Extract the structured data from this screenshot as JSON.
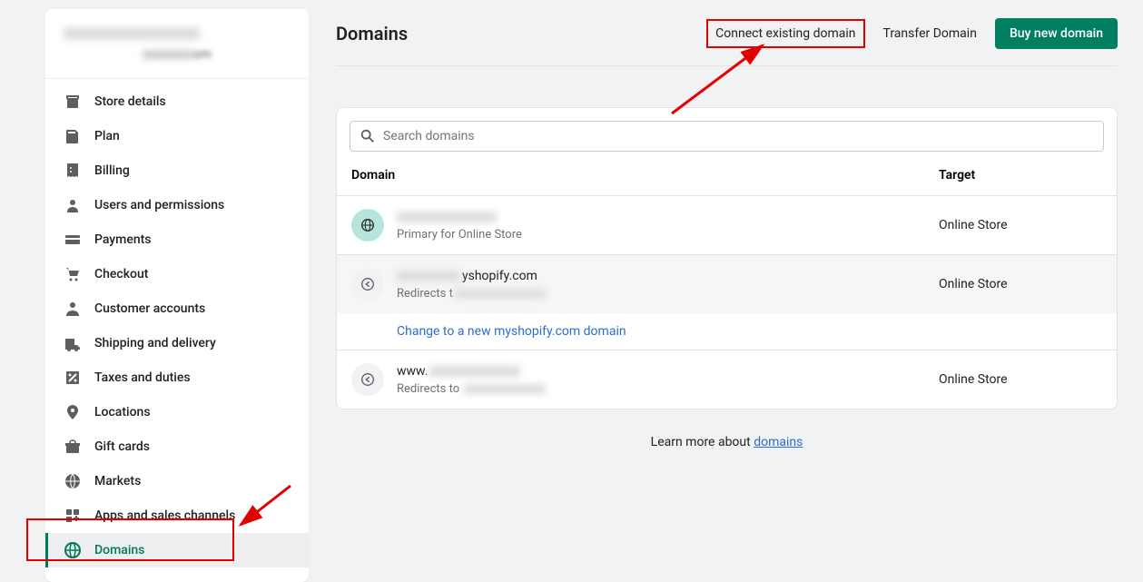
{
  "sidebar": {
    "shop_url_partial": "om",
    "items": [
      {
        "label": "Store details"
      },
      {
        "label": "Plan"
      },
      {
        "label": "Billing"
      },
      {
        "label": "Users and permissions"
      },
      {
        "label": "Payments"
      },
      {
        "label": "Checkout"
      },
      {
        "label": "Customer accounts"
      },
      {
        "label": "Shipping and delivery"
      },
      {
        "label": "Taxes and duties"
      },
      {
        "label": "Locations"
      },
      {
        "label": "Gift cards"
      },
      {
        "label": "Markets"
      },
      {
        "label": "Apps and sales channels"
      },
      {
        "label": "Domains"
      }
    ]
  },
  "header": {
    "title": "Domains",
    "connect_label": "Connect existing domain",
    "transfer_label": "Transfer Domain",
    "buy_label": "Buy new domain"
  },
  "search": {
    "placeholder": "Search domains"
  },
  "table": {
    "col_domain": "Domain",
    "col_target": "Target",
    "rows": [
      {
        "primary": true,
        "sub": "Primary for Online Store",
        "target": "Online Store"
      },
      {
        "primary": false,
        "title_suffix": "yshopify.com",
        "sub_prefix": "Redirects t",
        "target": "Online Store"
      },
      {
        "primary": false,
        "title_prefix": "www.",
        "sub_prefix": "Redirects to",
        "target": "Online Store"
      }
    ],
    "change_link": "Change to a new myshopify.com domain"
  },
  "learn_more_prefix": "Learn more about ",
  "learn_more_link": "domains"
}
